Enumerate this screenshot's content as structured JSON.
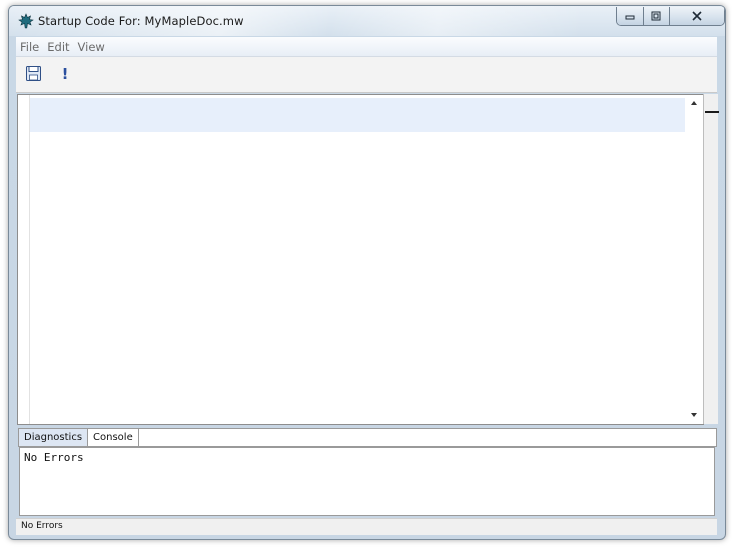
{
  "window": {
    "title": "Startup Code For: MyMapleDoc.mw",
    "icons": {
      "app": "maple-leaf-icon",
      "minimize": "minimize-icon",
      "maximize": "maximize-icon",
      "close": "close-icon"
    }
  },
  "menu": {
    "items": [
      "File",
      "Edit",
      "View"
    ]
  },
  "toolbar": {
    "save_icon": "floppy-disk-icon",
    "execute_label": "!"
  },
  "editor": {
    "content": ""
  },
  "tabs": [
    {
      "label": "Diagnostics",
      "active": true
    },
    {
      "label": "Console",
      "active": false
    }
  ],
  "output": {
    "text": "No Errors"
  },
  "status": {
    "text": "No Errors"
  },
  "colors": {
    "current_line": "#e7effb",
    "active_tab": "#dde6f3",
    "execute_icon": "#2b4f9e"
  }
}
